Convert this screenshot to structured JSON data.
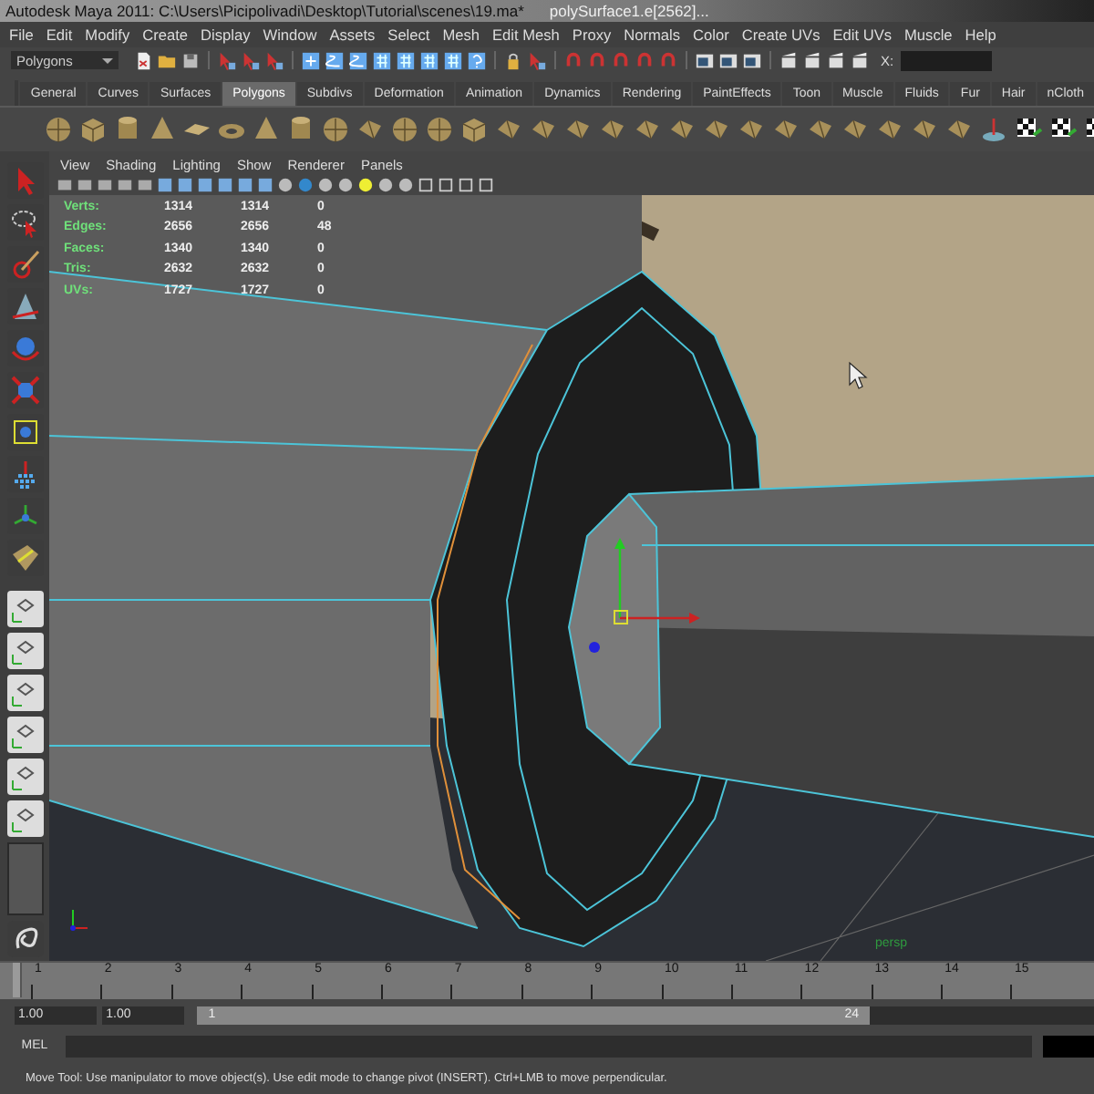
{
  "window": {
    "title": "Autodesk Maya 2011: C:\\Users\\Picipolivadi\\Desktop\\Tutorial\\scenes\\19.ma*",
    "subtitle": "polySurface1.e[2562]..."
  },
  "menu": [
    "File",
    "Edit",
    "Modify",
    "Create",
    "Display",
    "Window",
    "Assets",
    "Select",
    "Mesh",
    "Edit Mesh",
    "Proxy",
    "Normals",
    "Color",
    "Create UVs",
    "Edit UVs",
    "Muscle",
    "Help"
  ],
  "status_line": {
    "mode": "Polygons",
    "coord_label": "X:"
  },
  "shelf_tabs": [
    {
      "label": "General",
      "selected": false
    },
    {
      "label": "Curves",
      "selected": false
    },
    {
      "label": "Surfaces",
      "selected": false
    },
    {
      "label": "Polygons",
      "selected": true
    },
    {
      "label": "Subdivs",
      "selected": false
    },
    {
      "label": "Deformation",
      "selected": false
    },
    {
      "label": "Animation",
      "selected": false
    },
    {
      "label": "Dynamics",
      "selected": false
    },
    {
      "label": "Rendering",
      "selected": false
    },
    {
      "label": "PaintEffects",
      "selected": false
    },
    {
      "label": "Toon",
      "selected": false
    },
    {
      "label": "Muscle",
      "selected": false
    },
    {
      "label": "Fluids",
      "selected": false
    },
    {
      "label": "Fur",
      "selected": false
    },
    {
      "label": "Hair",
      "selected": false
    },
    {
      "label": "nCloth",
      "selected": false
    }
  ],
  "panel_menu": [
    "View",
    "Shading",
    "Lighting",
    "Show",
    "Renderer",
    "Panels"
  ],
  "hud": [
    {
      "label": "Verts:",
      "values": [
        "1314",
        "1314",
        "0"
      ]
    },
    {
      "label": "Edges:",
      "values": [
        "2656",
        "2656",
        "48"
      ]
    },
    {
      "label": "Faces:",
      "values": [
        "1340",
        "1340",
        "0"
      ]
    },
    {
      "label": "Tris:",
      "values": [
        "2632",
        "2632",
        "0"
      ]
    },
    {
      "label": "UVs:",
      "values": [
        "1727",
        "1727",
        "0"
      ]
    }
  ],
  "camera_label": "persp",
  "time_slider": {
    "level": 0,
    "ticks": [
      "1",
      "2",
      "3",
      "4",
      "5",
      "6",
      "7",
      "8",
      "9",
      "10",
      "11",
      "12",
      "13",
      "14",
      "15"
    ]
  },
  "range": {
    "level": 0.75,
    "start": "1.00",
    "current": "1.00",
    "min": "1",
    "max": "24"
  },
  "command_line": {
    "label": "MEL"
  },
  "help_line": "Move Tool: Use manipulator to move object(s). Use edit mode to change pivot (INSERT).  Ctrl+LMB to move perpendicular."
}
